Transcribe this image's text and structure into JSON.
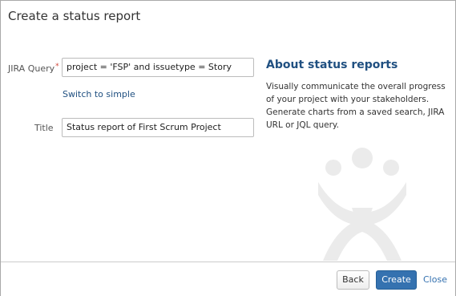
{
  "dialog": {
    "title": "Create a status report"
  },
  "form": {
    "jql_label": "JIRA Query",
    "required_marker": "*",
    "jql_value": "project = 'FSP' and issuetype = Story",
    "switch_link": "Switch to simple",
    "title_label": "Title",
    "title_value": "Status report of First Scrum Project"
  },
  "about": {
    "heading": "About status reports",
    "description": "Visually communicate the overall progress of your project with your stakeholders. Generate charts from a saved search, JIRA URL or JQL query."
  },
  "footer": {
    "back_label": "Back",
    "create_label": "Create",
    "close_label": "Close"
  },
  "colors": {
    "accent": "#205081",
    "primary_button": "#3572b0",
    "required": "#d04437",
    "watermark": "#ebebeb"
  }
}
